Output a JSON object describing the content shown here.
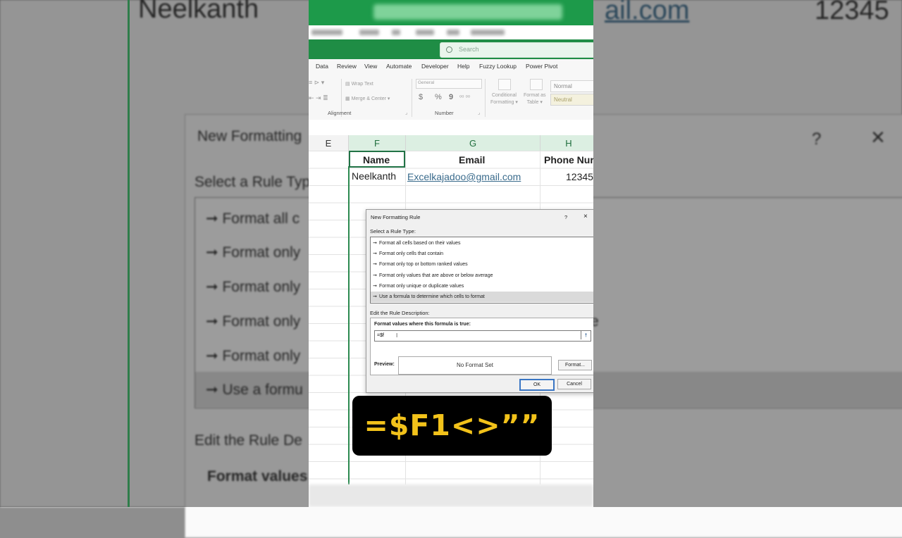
{
  "background": {
    "cells": {
      "name": "Neelkanth",
      "email": "ail.com",
      "phone": "12345"
    },
    "dialog_title": "New Formatting",
    "select_rule_type": "Select a Rule Typ",
    "items": [
      "Format all c",
      "Format only",
      "Format only",
      "Format only",
      "Format only",
      "Use a formu"
    ],
    "edit_rule": "Edit the Rule De",
    "format_values": "Format values",
    "help_glyph": "?",
    "close_glyph": "×",
    "e_glyph": "e"
  },
  "excel": {
    "search_placeholder": "Search",
    "menu": [
      "Data",
      "Review",
      "View",
      "Automate",
      "Developer",
      "Help",
      "Fuzzy Lookup",
      "Power Pivot"
    ],
    "ribbon": {
      "wrap_text": "Wrap Text",
      "merge_center": "Merge & Center",
      "number_format": "General",
      "alignment_label": "Alignment",
      "number_label": "Number",
      "currency": "$",
      "percent": "%",
      "comma": "9",
      "conditional_formatting_1": "Conditional",
      "conditional_formatting_2": "Formatting",
      "format_as_table_1": "Format as",
      "format_as_table_2": "Table",
      "style_normal": "Normal",
      "style_neutral": "Neutral"
    },
    "columns": [
      "E",
      "F",
      "G",
      "H"
    ],
    "headers": {
      "name": "Name",
      "email": "Email",
      "phone": "Phone Nur"
    },
    "row1": {
      "name": "Neelkanth",
      "email": "Excelkajadoo@gmail.com",
      "phone": "12345"
    }
  },
  "dialog": {
    "title": "New Formatting Rule",
    "help": "?",
    "close": "×",
    "select_rule_type": "Select a Rule Type:",
    "rule_types": [
      "Format all cells based on their values",
      "Format only cells that contain",
      "Format only top or bottom ranked values",
      "Format only values that are above or below average",
      "Format only unique or duplicate values",
      "Use a formula to determine which cells to format"
    ],
    "selected_index": 5,
    "edit_description": "Edit the Rule Description:",
    "formula_label": "Format values where this formula is true:",
    "formula_value": "=$f",
    "preview_label": "Preview:",
    "preview_text": "No Format Set",
    "format_button": "Format...",
    "ok_button": "OK",
    "cancel_button": "Cancel"
  },
  "caption": "=$F1<>””"
}
